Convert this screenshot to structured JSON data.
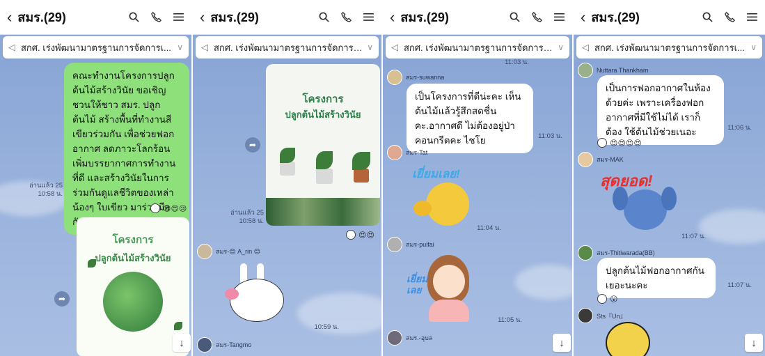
{
  "panels": [
    {
      "title": "สมร.(29)",
      "pinned": "สกศ. เร่งพัฒนามาตรฐานการจัดการเ...",
      "message": "คณะทำงานโครงการปลูกต้นไม้สร้างวินัย ขอเชิญชวนให้ชาว สมร. ปลูกต้นไม้ สร้างพื้นที่ทำงานสีเขียวร่วมกัน เพื่อช่วยฟอกอากาศ ลดภาวะโลกร้อน เพิ่มบรรยากาศการทำงานที่ดี และสร้างวินัยในการร่วมกันดูแลชีวิตของเหล่าน้องๆ ใบเขียว มาร่วมมือกันนะคะ",
      "read": "อ่านแล้ว 25",
      "time": "10:58 น.",
      "poster_title": "โครงการ",
      "poster_subtitle": "ปลูกต้นไม้สร้างวินัย"
    },
    {
      "title": "สมร.(29)",
      "pinned": "สกศ. เร่งพัฒนามาตรฐานการจัดการเ...",
      "poster_title": "โครงการ",
      "poster_subtitle": "ปลูกต้นไม้สร้างวินัย",
      "read": "อ่านแล้ว 25",
      "time1": "10:58 น.",
      "sender1": "สมร-😊 A_rin 😊",
      "time2": "10:59 น.",
      "sender2": "สมร-Tangmo"
    },
    {
      "title": "สมร.(29)",
      "pinned": "สกศ. เร่งพัฒนามาตรฐานการจัดการเ...",
      "time0": "11:03 น.",
      "sender1": "สมร-suwanna",
      "msg1": "เป็นโครงการที่ดีน่ะคะ เห็นต้นไม้แล้วรู้สึกสดชื่น คะ.อากาศดี ไม่ต้องอยู่ป่าคอนกรีตคะ ไชโย",
      "time1": "11:03 น.",
      "sender2": "สมร-Tat",
      "sticker2": "เยี่ยมเลย!",
      "time2": "11:04 น.",
      "sender3": "สมร-puifai",
      "sticker3": "เยี่ยม เลย",
      "time3": "11:05 น.",
      "sender4": "สมร.-อุบล"
    },
    {
      "title": "สมร.(29)",
      "pinned": "สกศ. เร่งพัฒนามาตรฐานการจัดการเ...",
      "sender1": "Nuttara Thankham",
      "msg1": "เป็นการฟอกอากาศในห้อง ด้วยค่ะ เพราะเครื่องฟอก อากาศที่มีใช้ไม่ได้ เราก็ต้อง ใช้ต้นไม้ช่วยเนอะ",
      "time1": "11:06 น.",
      "sender2": "สมร-MAK",
      "sticker2": "สุดยอด!",
      "time2": "11:07 น.",
      "sender3": "สมร-Thitiwarada(BB)",
      "msg3": "ปลูกต้นไม้ฟอกอากาศกัน เยอะนะคะ",
      "time3": "11:07 น.",
      "sender4": "Sts『Un』"
    }
  ]
}
